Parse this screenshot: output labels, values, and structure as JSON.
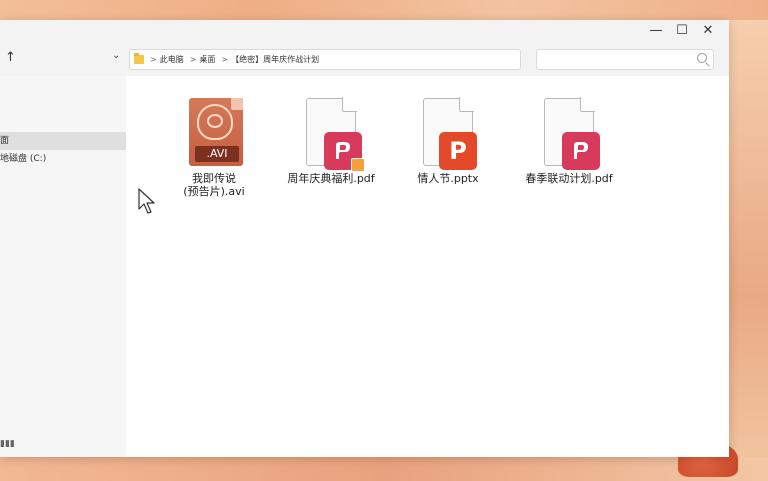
{
  "window": {
    "controls": {
      "minimize": "—",
      "maximize": "☐",
      "close": "✕"
    }
  },
  "navbar": {
    "up_glyph": "↑",
    "dropdown_glyph": "⌄",
    "breadcrumb": [
      "此电脑",
      "桌面",
      "【绝密】周年庆作战计划"
    ],
    "breadcrumb_sep": ">",
    "search_placeholder": ""
  },
  "sidebar": {
    "items": [
      {
        "label": "面",
        "selected": true
      },
      {
        "label": "地磁盘 (C:)",
        "selected": false
      }
    ],
    "status": "▮▮▮"
  },
  "files": [
    {
      "name_line1": "我即传说",
      "name_line2": "(预告片).avi",
      "type": "avi",
      "badge_text": ".AVI"
    },
    {
      "name_line1": "周年庆典福利.pdf",
      "name_line2": "",
      "type": "pdf",
      "locked": true
    },
    {
      "name_line1": "情人节.pptx",
      "name_line2": "",
      "type": "pptx",
      "badge_text": "P"
    },
    {
      "name_line1": "春季联动计划.pdf",
      "name_line2": "",
      "type": "pdf",
      "locked": false
    }
  ],
  "colors": {
    "pdf_badge": "#d83a5c",
    "ppt_badge": "#e44a2a",
    "avi_file": "#c55f3f",
    "selection": "#dfdfdf"
  }
}
